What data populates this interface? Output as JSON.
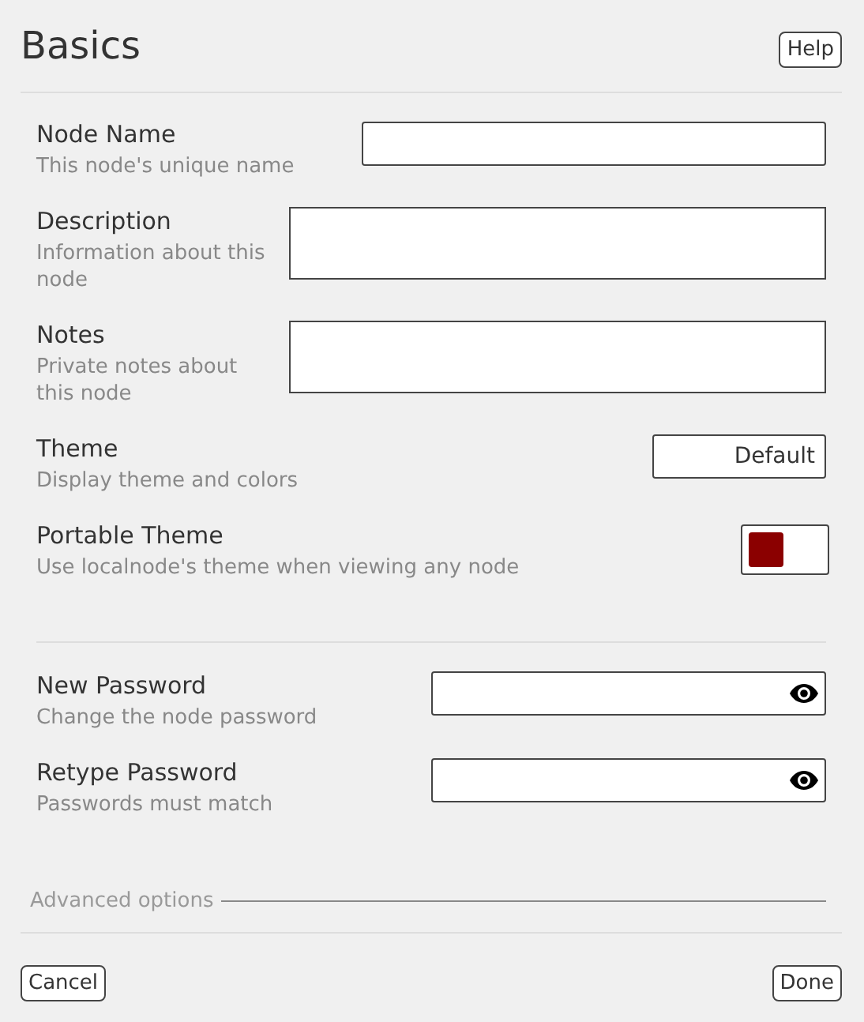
{
  "title": "Basics",
  "help_button": "Help",
  "groups": [
    [
      {
        "kind": "text",
        "label": "Node Name",
        "description": "This node's unique name"
      },
      {
        "kind": "textarea",
        "label": "Description",
        "description": "Information about this node"
      },
      {
        "kind": "textarea",
        "label": "Notes",
        "description": "Private notes about this node"
      },
      {
        "kind": "select",
        "label": "Theme",
        "description": "Display theme and colors",
        "value": "Default"
      },
      {
        "kind": "toggle",
        "label": "Portable Theme",
        "description": "Use localnode's theme when viewing any node",
        "on": false
      }
    ],
    [
      {
        "kind": "password",
        "label": "New Password",
        "description": "Change the node password"
      },
      {
        "kind": "password",
        "label": "Retype Password",
        "description": "Passwords must match"
      }
    ]
  ],
  "advanced_options": "Advanced options",
  "buttons": {
    "cancel": "Cancel",
    "done": "Done"
  }
}
